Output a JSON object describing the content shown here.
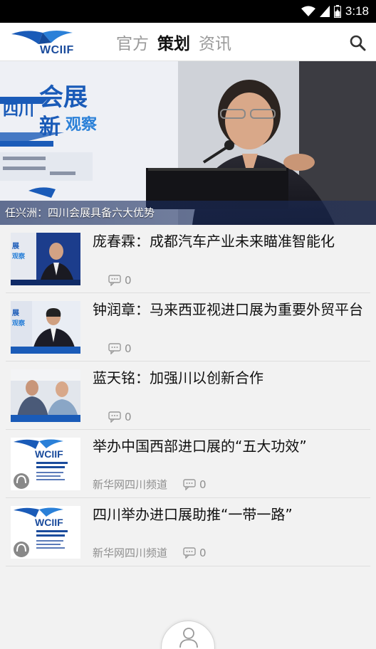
{
  "status_bar": {
    "time": "3:18"
  },
  "header": {
    "logo_text": "WCIIF",
    "tabs": [
      {
        "label": "官方",
        "active": false
      },
      {
        "label": "策划",
        "active": true
      },
      {
        "label": "资讯",
        "active": false
      }
    ],
    "search_icon": "search-icon"
  },
  "hero": {
    "caption": "任兴洲：四川会展具备六大优势"
  },
  "articles": [
    {
      "title": "庞春霖：成都汽车产业未来瞄准智能化",
      "source": "",
      "comments": "0"
    },
    {
      "title": "钟润章：马来西亚视进口展为重要外贸平台",
      "source": "",
      "comments": "0"
    },
    {
      "title": "蓝天铭：加强川以创新合作",
      "source": "",
      "comments": "0"
    },
    {
      "title": "举办中国西部进口展的“五大功效”",
      "source": "新华网四川频道",
      "comments": "0"
    },
    {
      "title": "四川举办进口展助推“一带一路”",
      "source": "新华网四川频道",
      "comments": "0"
    }
  ],
  "colors": {
    "brand": "#1a4b9c",
    "accent": "#2f6fd0"
  }
}
